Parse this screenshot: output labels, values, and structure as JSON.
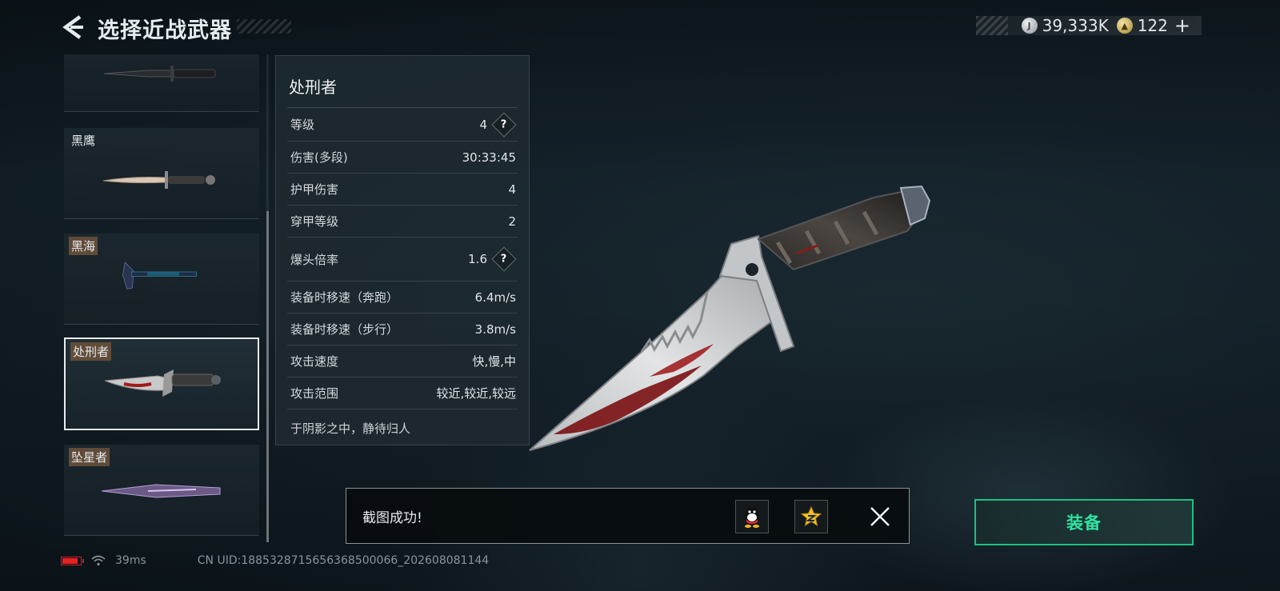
{
  "header": {
    "title": "选择近战武器",
    "currency_silver": "39,333K",
    "currency_gold": "122",
    "plus_label": "+"
  },
  "weapons": [
    {
      "name": ""
    },
    {
      "name": "黑鹰"
    },
    {
      "name": "黑海"
    },
    {
      "name": "处刑者",
      "selected": true
    },
    {
      "name": "坠星者"
    }
  ],
  "stats": {
    "name": "处刑者",
    "rows": [
      {
        "label": "等级",
        "value": "4",
        "help": true
      },
      {
        "label": "伤害(多段)",
        "value": "30:33:45"
      },
      {
        "label": "护甲伤害",
        "value": "4"
      },
      {
        "label": "穿甲等级",
        "value": "2"
      },
      {
        "label": "爆头倍率",
        "value": "1.6",
        "help": true
      },
      {
        "label": "装备时移速（奔跑）",
        "value": "6.4m/s"
      },
      {
        "label": "装备时移速（步行）",
        "value": "3.8m/s"
      },
      {
        "label": "攻击速度",
        "value": "快,慢,中"
      },
      {
        "label": "攻击范围",
        "value": "较近,较近,较远"
      }
    ],
    "description": "于阴影之中，静待归人",
    "help_symbol": "?"
  },
  "toast": {
    "message": "截图成功!",
    "buttons": [
      "qq-icon",
      "qzone-star-icon"
    ]
  },
  "equip_label": "装备",
  "status": {
    "ping": "39ms",
    "uid": "CN UID:1885328715656368500066_202608081144",
    "battery_level": 0.85,
    "battery_color": "#e32222"
  },
  "colors": {
    "accent_green": "#2fe3a0",
    "equip_border": "#1fbf83"
  }
}
